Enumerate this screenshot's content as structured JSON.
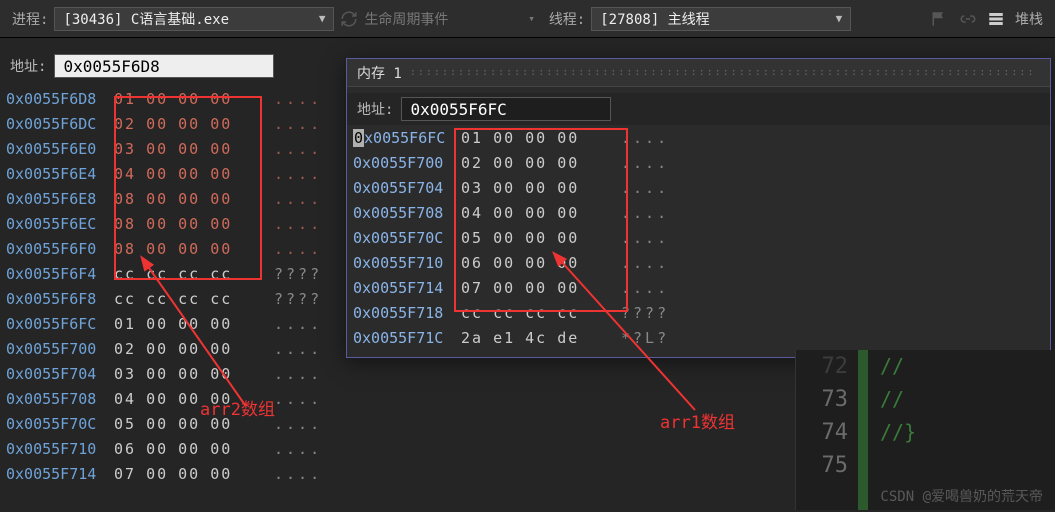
{
  "toolbar": {
    "process_label": "进程:",
    "process_value": "[30436] C语言基础.exe",
    "lifecycle_label": "生命周期事件",
    "thread_label": "线程:",
    "thread_value": "[27808] 主线程",
    "stack_label": "堆栈"
  },
  "left_memory": {
    "address_label": "地址:",
    "address_value": "0x0055F6D8",
    "rows": [
      {
        "addr": "0x0055F6D8",
        "b": [
          "01",
          "00",
          "00",
          "00"
        ],
        "asc": "....",
        "hl": true
      },
      {
        "addr": "0x0055F6DC",
        "b": [
          "02",
          "00",
          "00",
          "00"
        ],
        "asc": "....",
        "hl": true
      },
      {
        "addr": "0x0055F6E0",
        "b": [
          "03",
          "00",
          "00",
          "00"
        ],
        "asc": "....",
        "hl": true
      },
      {
        "addr": "0x0055F6E4",
        "b": [
          "04",
          "00",
          "00",
          "00"
        ],
        "asc": "....",
        "hl": true
      },
      {
        "addr": "0x0055F6E8",
        "b": [
          "08",
          "00",
          "00",
          "00"
        ],
        "asc": "....",
        "hl": true
      },
      {
        "addr": "0x0055F6EC",
        "b": [
          "08",
          "00",
          "00",
          "00"
        ],
        "asc": "....",
        "hl": true
      },
      {
        "addr": "0x0055F6F0",
        "b": [
          "08",
          "00",
          "00",
          "00"
        ],
        "asc": "....",
        "hl": true
      },
      {
        "addr": "0x0055F6F4",
        "b": [
          "cc",
          "cc",
          "cc",
          "cc"
        ],
        "asc": "????",
        "hl": false
      },
      {
        "addr": "0x0055F6F8",
        "b": [
          "cc",
          "cc",
          "cc",
          "cc"
        ],
        "asc": "????",
        "hl": false
      },
      {
        "addr": "0x0055F6FC",
        "b": [
          "01",
          "00",
          "00",
          "00"
        ],
        "asc": "....",
        "hl": false
      },
      {
        "addr": "0x0055F700",
        "b": [
          "02",
          "00",
          "00",
          "00"
        ],
        "asc": "....",
        "hl": false
      },
      {
        "addr": "0x0055F704",
        "b": [
          "03",
          "00",
          "00",
          "00"
        ],
        "asc": "....",
        "hl": false
      },
      {
        "addr": "0x0055F708",
        "b": [
          "04",
          "00",
          "00",
          "00"
        ],
        "asc": "....",
        "hl": false
      },
      {
        "addr": "0x0055F70C",
        "b": [
          "05",
          "00",
          "00",
          "00"
        ],
        "asc": "....",
        "hl": false
      },
      {
        "addr": "0x0055F710",
        "b": [
          "06",
          "00",
          "00",
          "00"
        ],
        "asc": "....",
        "hl": false
      },
      {
        "addr": "0x0055F714",
        "b": [
          "07",
          "00",
          "00",
          "00"
        ],
        "asc": "....",
        "hl": false
      }
    ]
  },
  "overlay_memory": {
    "title": "内存 1",
    "address_label": "地址:",
    "address_value": "0x0055F6FC",
    "rows": [
      {
        "addr": "0x0055F6FC",
        "b": [
          "01",
          "00",
          "00",
          "00"
        ],
        "asc": "...."
      },
      {
        "addr": "0x0055F700",
        "b": [
          "02",
          "00",
          "00",
          "00"
        ],
        "asc": "...."
      },
      {
        "addr": "0x0055F704",
        "b": [
          "03",
          "00",
          "00",
          "00"
        ],
        "asc": "...."
      },
      {
        "addr": "0x0055F708",
        "b": [
          "04",
          "00",
          "00",
          "00"
        ],
        "asc": "...."
      },
      {
        "addr": "0x0055F70C",
        "b": [
          "05",
          "00",
          "00",
          "00"
        ],
        "asc": "...."
      },
      {
        "addr": "0x0055F710",
        "b": [
          "06",
          "00",
          "00",
          "00"
        ],
        "asc": "...."
      },
      {
        "addr": "0x0055F714",
        "b": [
          "07",
          "00",
          "00",
          "00"
        ],
        "asc": "...."
      },
      {
        "addr": "0x0055F718",
        "b": [
          "cc",
          "cc",
          "cc",
          "cc"
        ],
        "asc": "????"
      },
      {
        "addr": "0x0055F71C",
        "b": [
          "2a",
          "e1",
          "4c",
          "de"
        ],
        "asc": "*?L?"
      }
    ]
  },
  "annotations": {
    "left_label": "arr2数组",
    "right_label": "arr1数组"
  },
  "code_strip": {
    "lines": [
      {
        "n": "72",
        "t": "//"
      },
      {
        "n": "73",
        "t": "//"
      },
      {
        "n": "74",
        "t": "//}"
      },
      {
        "n": "75",
        "t": ""
      }
    ]
  },
  "watermark": "CSDN @爱喝兽奶的荒天帝"
}
